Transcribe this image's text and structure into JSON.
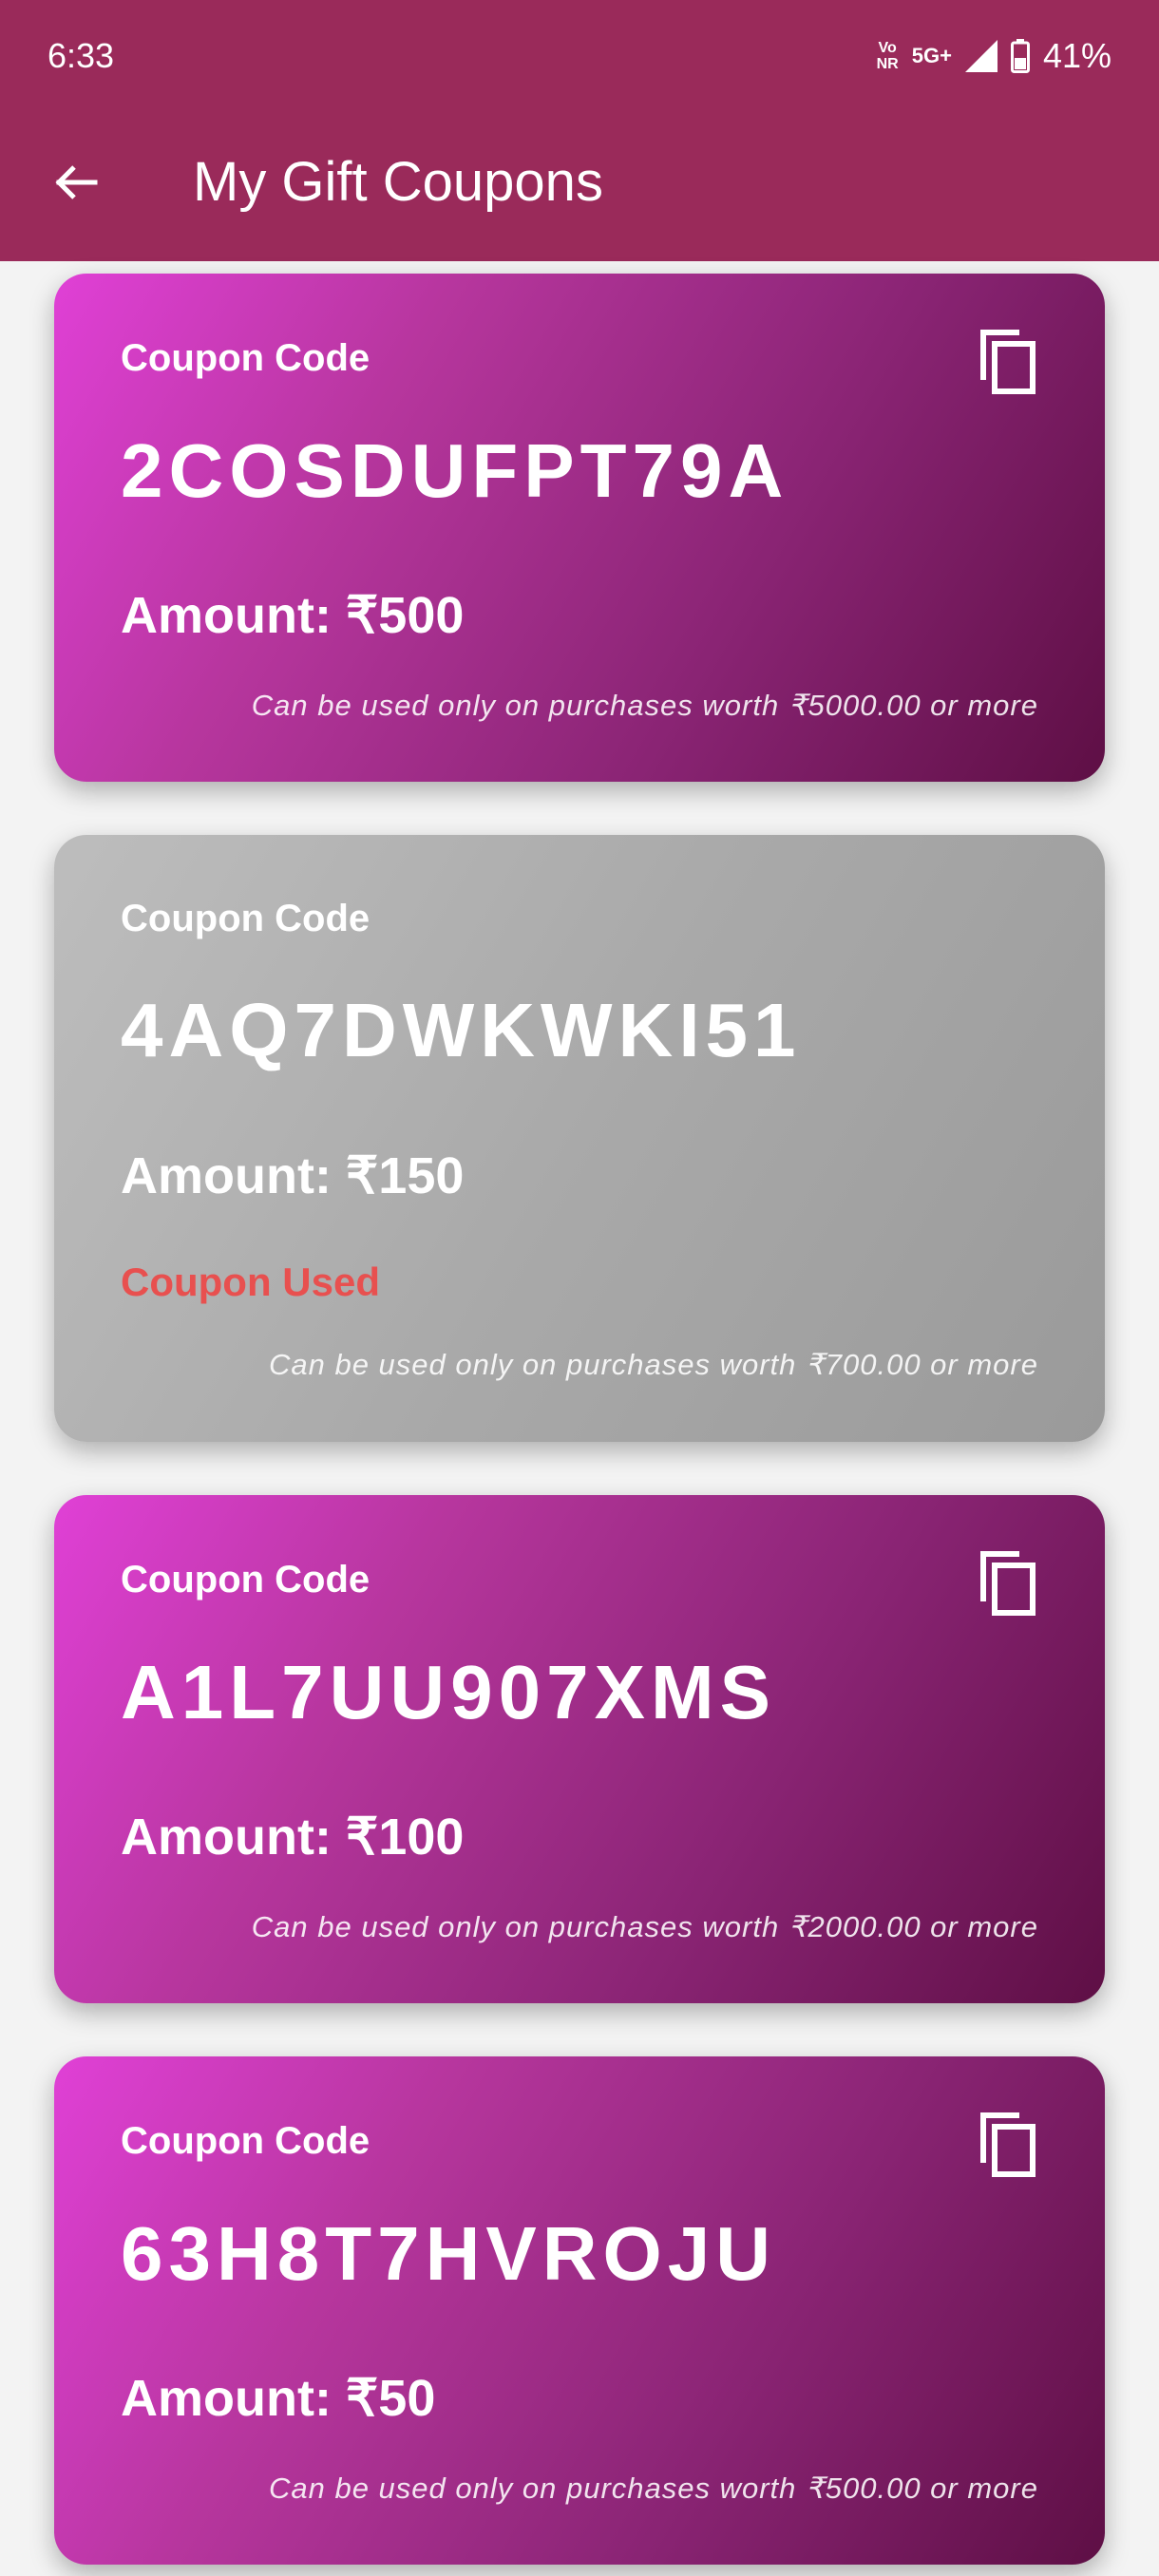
{
  "status": {
    "time": "6:33",
    "net_top": "Vo",
    "net_bottom": "NR",
    "network": "5G+",
    "battery": "41%"
  },
  "app_bar": {
    "title": "My Gift Coupons",
    "back_icon": "arrow-back-icon"
  },
  "colors": {
    "app_bar": "#9a2a5a",
    "card_gradient_start": "#e040d6",
    "card_gradient_end": "#5e0f45",
    "used_card": "#a9a9a9",
    "used_text": "#e8504f"
  },
  "coupons": [
    {
      "label": "Coupon Code",
      "code": "2COSDUFPT79A",
      "amount": "Amount: ₹500",
      "note": "Can be used only on purchases worth ₹5000.00 or more",
      "used": false,
      "copy_icon": "copy-icon"
    },
    {
      "label": "Coupon Code",
      "code": "4AQ7DWKWKI51",
      "amount": "Amount: ₹150",
      "status": "Coupon Used",
      "note": "Can be used only on purchases worth ₹700.00 or more",
      "used": true
    },
    {
      "label": "Coupon Code",
      "code": "A1L7UU907XMS",
      "amount": "Amount: ₹100",
      "note": "Can be used only on purchases worth ₹2000.00 or more",
      "used": false,
      "copy_icon": "copy-icon"
    },
    {
      "label": "Coupon Code",
      "code": "63H8T7HVROJU",
      "amount": "Amount: ₹50",
      "note": "Can be used only on purchases worth ₹500.00 or more",
      "used": false,
      "copy_icon": "copy-icon"
    }
  ]
}
